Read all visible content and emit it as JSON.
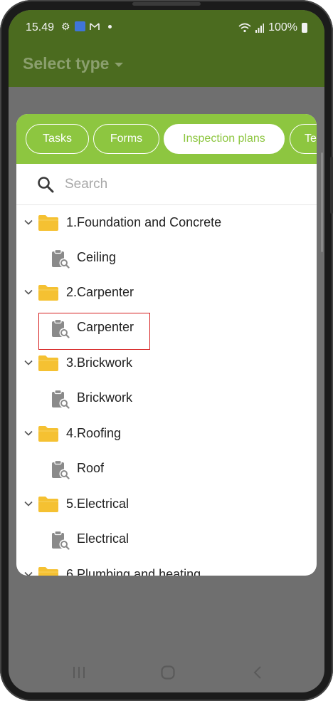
{
  "status_bar": {
    "time": "15.49",
    "battery": "100%"
  },
  "app_bar": {
    "title": "Select type"
  },
  "tabs": [
    {
      "label": "Tasks",
      "active": false
    },
    {
      "label": "Forms",
      "active": false
    },
    {
      "label": "Inspection plans",
      "active": true
    },
    {
      "label": "Te",
      "active": false
    }
  ],
  "search": {
    "placeholder": "Search",
    "value": ""
  },
  "tree": {
    "folders": [
      {
        "label": "1.Foundation and Concrete",
        "items": [
          {
            "label": "Ceiling"
          }
        ]
      },
      {
        "label": "2.Carpenter",
        "items": [
          {
            "label": "Carpenter",
            "highlighted": true
          }
        ]
      },
      {
        "label": "3.Brickwork",
        "items": [
          {
            "label": "Brickwork"
          }
        ]
      },
      {
        "label": "4.Roofing",
        "items": [
          {
            "label": "Roof"
          }
        ]
      },
      {
        "label": "5.Electrical",
        "items": [
          {
            "label": "Electrical"
          }
        ]
      },
      {
        "label": "6.Plumbing and heating",
        "items": []
      }
    ]
  },
  "colors": {
    "accent_green": "#8dc640",
    "folder_yellow": "#f5c132",
    "highlight_red": "#d62020"
  }
}
